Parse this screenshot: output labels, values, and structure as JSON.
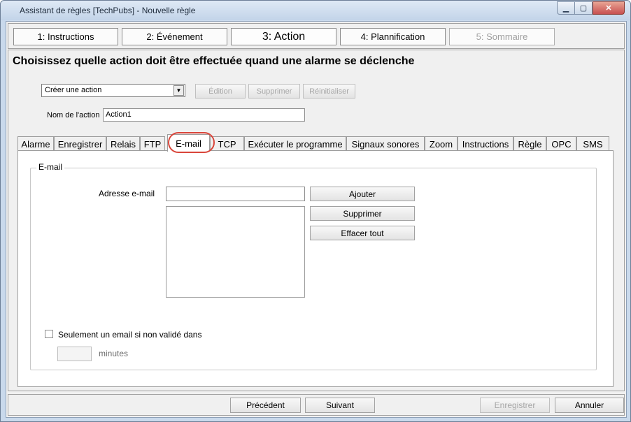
{
  "window": {
    "title": "Assistant de règles [TechPubs] - Nouvelle règle",
    "controls": {
      "minimize": "▁",
      "maximize": "▢",
      "close": "✕"
    }
  },
  "steps": [
    {
      "label": "1: Instructions",
      "state": "normal"
    },
    {
      "label": "2: Événement",
      "state": "normal"
    },
    {
      "label": "3: Action",
      "state": "active"
    },
    {
      "label": "4: Plannification",
      "state": "normal"
    },
    {
      "label": "5: Sommaire",
      "state": "disabled"
    }
  ],
  "heading": "Choisissez quelle action doit être effectuée quand une alarme se déclenche",
  "action_select": {
    "value": "Créer une action",
    "arrow": "▼"
  },
  "action_buttons": {
    "edit": "Édition",
    "delete": "Supprimer",
    "reset": "Réinitialiser"
  },
  "action_name": {
    "label": "Nom de l'action",
    "value": "Action1"
  },
  "tabs": [
    "Alarme",
    "Enregistrer",
    "Relais",
    "FTP",
    "E-mail",
    "TCP",
    "Exécuter le programme",
    "Signaux sonores",
    "Zoom",
    "Instructions",
    "Règle",
    "OPC",
    "SMS"
  ],
  "selected_tab": "E-mail",
  "highlight_color": "#d9453a",
  "email_panel": {
    "group_title": "E-mail",
    "address_label": "Adresse e-mail",
    "address_value": "",
    "add_button": "Ajouter",
    "remove_button": "Supprimer",
    "clear_button": "Effacer tout",
    "only_once_label": "Seulement un email si non validé dans",
    "only_once_checked": false,
    "minutes_value": "",
    "minutes_label": "minutes"
  },
  "footer": {
    "previous": "Précédent",
    "next": "Suivant",
    "save": "Enregistrer",
    "cancel": "Annuler"
  }
}
